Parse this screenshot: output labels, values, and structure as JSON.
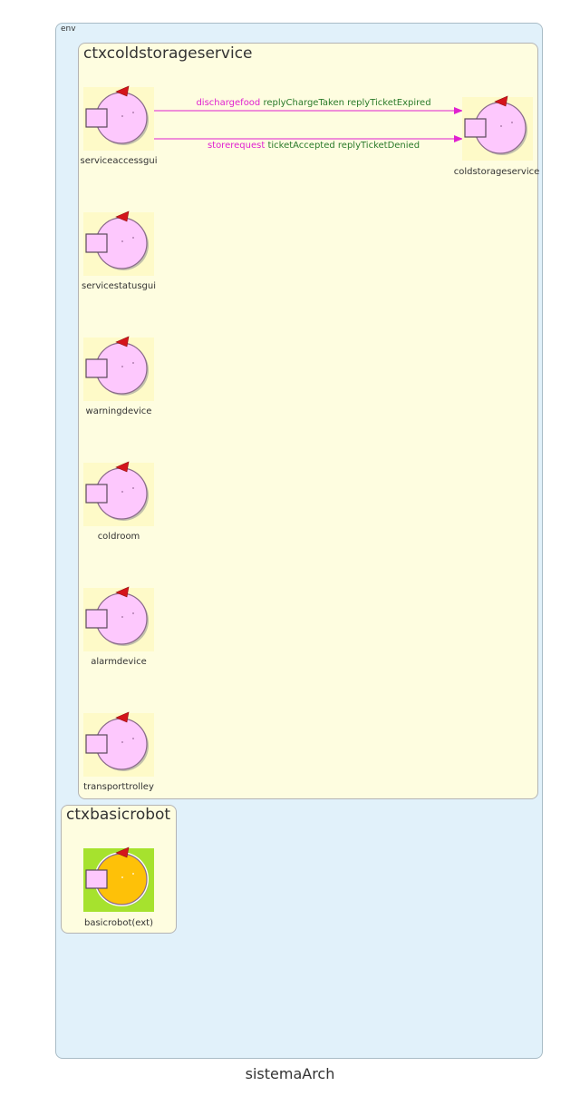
{
  "diagram": {
    "title": "sistemaArch",
    "env_label": "env",
    "contexts": [
      {
        "name": "ctxcoldstorageservice"
      },
      {
        "name": "ctxbasicrobot"
      }
    ],
    "actors": [
      {
        "name": "serviceaccessgui",
        "context": "ctxcoldstorageservice"
      },
      {
        "name": "coldstorageservice",
        "context": "ctxcoldstorageservice"
      },
      {
        "name": "servicestatusgui",
        "context": "ctxcoldstorageservice"
      },
      {
        "name": "warningdevice",
        "context": "ctxcoldstorageservice"
      },
      {
        "name": "coldroom",
        "context": "ctxcoldstorageservice"
      },
      {
        "name": "alarmdevice",
        "context": "ctxcoldstorageservice"
      },
      {
        "name": "transporttrolley",
        "context": "ctxcoldstorageservice"
      },
      {
        "name": "basicrobot(ext)",
        "context": "ctxbasicrobot",
        "external": true
      }
    ],
    "edges": [
      {
        "from": "serviceaccessgui",
        "to": "coldstorageservice",
        "request": "dischargefood",
        "replies": "replyChargeTaken replyTicketExpired"
      },
      {
        "from": "serviceaccessgui",
        "to": "coldstorageservice",
        "request": "storerequest",
        "replies": "ticketAccepted replyTicketDenied"
      }
    ],
    "colors": {
      "env_fill": "#e1f1fa",
      "context_fill": "#fefde0",
      "actor_fill": "#fdc8fd",
      "external_actor_fill": "#fec108",
      "external_bg": "#a6e22e",
      "arrow": "#e020d0",
      "request_text": "#e020d0",
      "reply_text": "#2a7a2a"
    },
    "icons": [
      "actor-icon",
      "red-triangle-icon",
      "port-square-icon"
    ]
  }
}
